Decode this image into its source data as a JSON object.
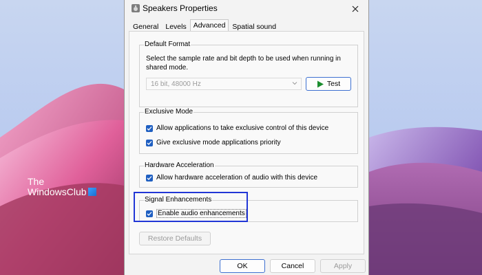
{
  "watermark": {
    "line1": "The",
    "line2": "WindowsClub"
  },
  "dialog": {
    "title": "Speakers Properties",
    "tabs": [
      {
        "label": "General"
      },
      {
        "label": "Levels"
      },
      {
        "label": "Advanced"
      },
      {
        "label": "Spatial sound"
      }
    ],
    "active_tab": "Advanced",
    "default_format": {
      "legend": "Default Format",
      "description": "Select the sample rate and bit depth to be used when running in shared mode.",
      "format_value": "16 bit, 48000 Hz",
      "test_label": "Test"
    },
    "exclusive_mode": {
      "legend": "Exclusive Mode",
      "options": [
        {
          "label": "Allow applications to take exclusive control of this device",
          "checked": true
        },
        {
          "label": "Give exclusive mode applications priority",
          "checked": true
        }
      ]
    },
    "hardware_acceleration": {
      "legend": "Hardware Acceleration",
      "option": {
        "label": "Allow hardware acceleration of audio with this device",
        "checked": true
      }
    },
    "signal_enhancements": {
      "legend": "Signal Enhancements",
      "option": {
        "label": "Enable audio enhancements",
        "checked": true
      }
    },
    "restore_defaults_label": "Restore Defaults",
    "footer": {
      "ok": "OK",
      "cancel": "Cancel",
      "apply": "Apply"
    }
  },
  "colors": {
    "accent": "#1f5fc1",
    "highlight": "#2136d6"
  }
}
